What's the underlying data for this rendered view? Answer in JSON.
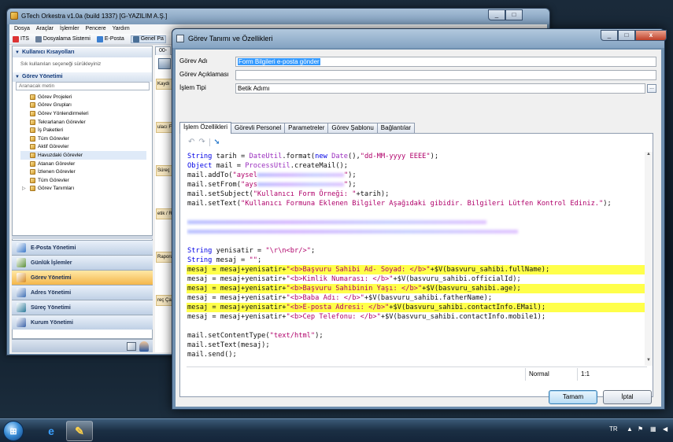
{
  "back_window": {
    "title": "GTech Orkestra v1.0a (build 1337) [G-YAZILIM A.Ş.]",
    "menu": [
      "Dosya",
      "Araçlar",
      "İşlemler",
      "Pencere",
      "Yardım"
    ],
    "toolbar": [
      "ITS",
      "Dosyalama Sistemi",
      "E-Posta",
      "Genel Pa"
    ],
    "shortcuts_header": "Kullanıcı Kısayolları",
    "shortcuts_hint": "Sık kullanılan seçeneği sürükleyiniz",
    "task_header": "Görev Yönetimi",
    "search_placeholder": "Aranacak metin",
    "tree_items": [
      "Görev Projeleri",
      "Görev Grupları",
      "Görev Yönlendirmeleri",
      "Tekrarlanan Görevler",
      "İş Paketleri",
      "Tüm Görevler",
      "Aktif Görevler",
      "Havuzdaki Görevler",
      "Atanan Görevler",
      "İzlenen Görevler",
      "Tüm Görevler",
      "Görev Tanımları"
    ],
    "selected_tree_index": 7,
    "nav_buttons": [
      "E-Posta Yönetimi",
      "Günlük İşlemler",
      "Görev Yönetimi",
      "Adres Yönetimi",
      "Süreç Yönetimi",
      "Kurum Yönetimi"
    ],
    "active_nav_index": 2,
    "doc_tab": "00-",
    "strip_labels": [
      "Kaydı",
      "ulacı Fo",
      "Süreç",
      "etik / R",
      "Raporu",
      "reç Çal"
    ]
  },
  "dialog": {
    "title": "Görev Tanımı ve Özellikleri",
    "fields": {
      "name_label": "Görev Adı",
      "name_value": "Form Bilgileri e-posta gönder",
      "desc_label": "Görev Açıklaması",
      "desc_value": "",
      "type_label": "İşlem Tipi",
      "type_value": "Betik Adımı",
      "more_button": "..."
    },
    "tabs": [
      "İşlem Özellikleri",
      "Görevli Personel",
      "Parametreler",
      "Görev Şablonu",
      "Bağlantılar"
    ],
    "active_tab": 0,
    "code": {
      "lines": [
        {
          "text": "String tarih = DateUtil.format(new Date(),\"dd-MM-yyyy EEEE\");",
          "highlight": false,
          "redacted": false
        },
        {
          "text": "Object mail = ProcessUtil.createMail();",
          "highlight": false,
          "redacted": false
        },
        {
          "text": "mail.addTo(\"aysel",
          "highlight": false,
          "redacted": true,
          "tail": "\");"
        },
        {
          "text": "mail.setFrom(\"ays",
          "highlight": false,
          "redacted": true,
          "tail": "\");"
        },
        {
          "text": "mail.setSubject(\"Kullanıcı Form Örneği: \"+tarih);",
          "highlight": false,
          "redacted": false
        },
        {
          "text": "mail.setText(\"Kullanıcı Formuna Eklenen Bilgiler Aşağıdaki gibidir. Bilgileri Lütfen Kontrol Ediniz.\");",
          "highlight": false,
          "redacted": false
        },
        {
          "text": "",
          "highlight": false,
          "redacted": false
        },
        {
          "text": "",
          "highlight": false,
          "redacted": true,
          "tail": ""
        },
        {
          "text": "",
          "highlight": false,
          "redacted": true,
          "tail": ""
        },
        {
          "text": "",
          "highlight": false,
          "redacted": false
        },
        {
          "text": "String yenisatir = \"\\r\\n<br/>\";",
          "highlight": false,
          "redacted": false
        },
        {
          "text": "String mesaj = \"\";",
          "highlight": false,
          "redacted": false
        },
        {
          "text": "mesaj = mesaj+yenisatir+\"<b>Başvuru Sahibi Ad- Soyad: </b>\"+$V(basvuru_sahibi.fullName);",
          "highlight": true,
          "redacted": false
        },
        {
          "text": "mesaj = mesaj+yenisatir+\"<b>Kimlik Numarası: </b>\"+$V(basvuru_sahibi.officialId);",
          "highlight": false,
          "redacted": false
        },
        {
          "text": "mesaj = mesaj+yenisatir+\"<b>Başvuru Sahibinin Yaşı: </b>\"+$V(basvuru_sahibi.age);",
          "highlight": true,
          "redacted": false
        },
        {
          "text": "mesaj = mesaj+yenisatir+\"<b>Baba Adı: </b>\"+$V(basvuru_sahibi.fatherName);",
          "highlight": false,
          "redacted": false
        },
        {
          "text": "mesaj = mesaj+yenisatir+\"<b>E-posta Adresi: </b>\"+$V(basvuru_sahibi.contactInfo.EMail);",
          "highlight": true,
          "redacted": false
        },
        {
          "text": "mesaj = mesaj+yenisatir+\"<b>Cep Telefonu: </b>\"+$V(basvuru_sahibi.contactInfo.mobile1);",
          "highlight": false,
          "redacted": false
        },
        {
          "text": "",
          "highlight": false,
          "redacted": false
        },
        {
          "text": "mail.setContentType(\"text/html\");",
          "highlight": false,
          "redacted": false
        },
        {
          "text": "mail.setText(mesaj);",
          "highlight": false,
          "redacted": false
        },
        {
          "text": "mail.send();",
          "highlight": false,
          "redacted": false
        }
      ]
    },
    "status": {
      "mode": "Normal",
      "position": "1:1"
    },
    "ok_button": "Tamam",
    "cancel_button": "İptal"
  },
  "taskbar": {
    "language": "TR"
  }
}
